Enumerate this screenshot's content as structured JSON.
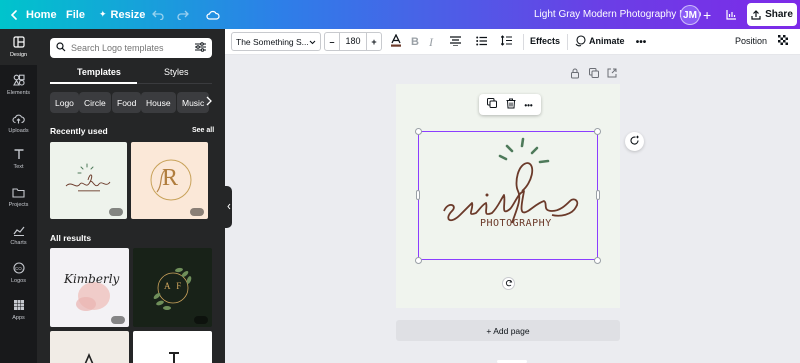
{
  "header": {
    "home_label": "Home",
    "file_label": "File",
    "resize_label": "Resize",
    "doc_title": "Light Gray Modern Photography Logo",
    "avatar_initials": "JM",
    "share_label": "Share",
    "icons": [
      "chevron-left-icon",
      "sparkle-icon",
      "undo-icon",
      "redo-icon",
      "cloud-save-icon",
      "plus-icon",
      "chart-icon",
      "upload-icon"
    ]
  },
  "rail": {
    "items": [
      {
        "label": "Design",
        "icon": "design-icon",
        "active": true
      },
      {
        "label": "Elements",
        "icon": "elements-icon"
      },
      {
        "label": "Uploads",
        "icon": "upload-cloud-icon"
      },
      {
        "label": "Text",
        "icon": "text-icon"
      },
      {
        "label": "Projects",
        "icon": "folder-icon"
      },
      {
        "label": "Charts",
        "icon": "charts-icon"
      },
      {
        "label": "Logos",
        "icon": "logos-icon"
      },
      {
        "label": "Apps",
        "icon": "apps-icon"
      }
    ]
  },
  "panel": {
    "search_placeholder": "Search Logo templates",
    "tabs": [
      "Templates",
      "Styles"
    ],
    "chips": [
      "Logo",
      "Circle",
      "Food",
      "House",
      "Music"
    ],
    "recently_used_label": "Recently used",
    "see_all_label": "See all",
    "all_results_label": "All results"
  },
  "toolbar": {
    "font_name": "The Something S...",
    "font_size": "180",
    "effects_label": "Effects",
    "animate_label": "Animate",
    "position_label": "Position",
    "text_color": "#6b3a2a"
  },
  "canvas": {
    "logo_main_text": "smiles",
    "logo_sub_text": "PHOTOGRAPHY",
    "add_page_label": "+ Add page",
    "accent_color": "#8b3dff",
    "brand_green": "#4e7a5a",
    "brand_brown": "#6b3a2a"
  },
  "thumbnails": {
    "recent_2_letter": "R",
    "result_1_text": "Kimberly",
    "result_2_letters": "A F"
  }
}
